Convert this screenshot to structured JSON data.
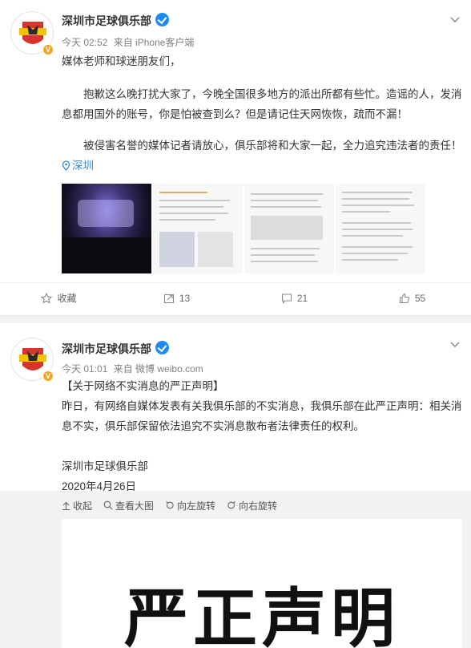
{
  "posts": [
    {
      "author": "深圳市足球俱乐部",
      "time": "今天 02:52",
      "source": "来自 iPhone客户端",
      "paragraphs": [
        "媒体老师和球迷朋友们，",
        "抱歉这么晚打扰大家了，今晚全国很多地方的派出所都有些忙。造谣的人，发消息都用国外的账号，你是怕被查到么？但是请记住天网恢恢，疏而不漏！",
        "被侵害名誉的媒体记者请放心，俱乐部将和大家一起，全力追究违法者的责任！"
      ],
      "location": "深圳",
      "actions": {
        "favorite": "收藏",
        "repost": "13",
        "comment": "21",
        "like": "55"
      }
    },
    {
      "author": "深圳市足球俱乐部",
      "time": "今天 01:01",
      "source": "来自 微博 weibo.com",
      "paragraphs": [
        "【关于网络不实消息的严正声明】",
        "昨日，有网络自媒体发表有关我俱乐部的不实消息，我俱乐部在此严正声明：相关消息不实，俱乐部保留依法追究不实消息散布者法律责任的权利。",
        "深圳市足球俱乐部",
        "2020年4月26日"
      ],
      "image_tools": [
        "收起",
        "查看大图",
        "向左旋转",
        "向右旋转"
      ],
      "image_title": "严正声明"
    }
  ],
  "colors": {
    "link": "#3a89c6",
    "verified": "#1f8bf0",
    "accent_avatar": "#d9342b"
  }
}
